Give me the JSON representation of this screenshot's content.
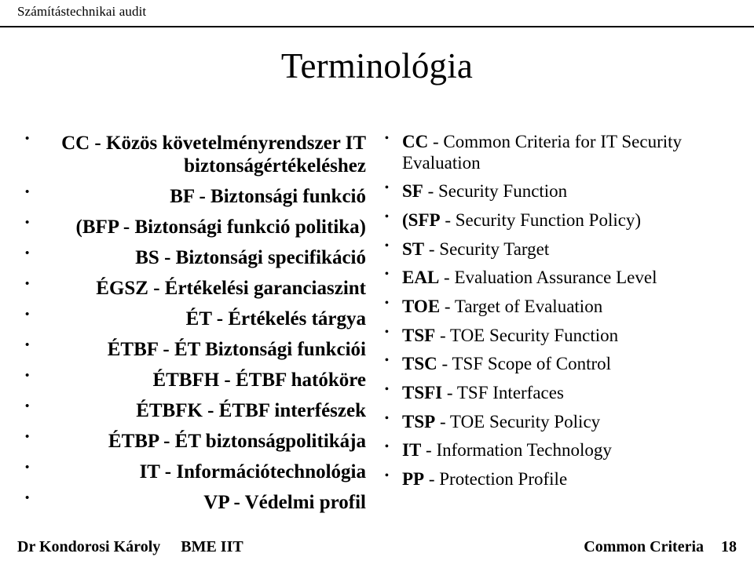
{
  "header": {
    "text": "Számítástechnikai audit"
  },
  "title": "Terminológia",
  "left_column": [
    "CC - Közös követelményrendszer IT biztonságértékeléshez",
    "BF - Biztonsági funkció",
    "(BFP - Biztonsági funkció politika)",
    "BS - Biztonsági specifikáció",
    "ÉGSZ - Értékelési garanciaszint",
    "ÉT - Értékelés tárgya",
    "ÉTBF - ÉT Biztonsági funkciói",
    "ÉTBFH - ÉTBF hatóköre",
    "ÉTBFK - ÉTBF interfészek",
    "ÉTBP - ÉT biztonságpolitikája",
    "IT - Információtechnológia",
    "VP - Védelmi profil"
  ],
  "right_column": [
    {
      "bold": "CC",
      "rest": " - Common Criteria for IT Security Evaluation"
    },
    {
      "bold": "SF",
      "rest": " - Security Function"
    },
    {
      "bold": "(SFP",
      "rest": " - Security Function Policy)"
    },
    {
      "bold": "ST",
      "rest": " - Security Target"
    },
    {
      "bold": "EAL",
      "rest": " - Evaluation Assurance Level"
    },
    {
      "bold": "TOE",
      "rest": " - Target of Evaluation"
    },
    {
      "bold": "TSF",
      "rest": " - TOE Security Function"
    },
    {
      "bold": "TSC",
      "rest": " - TSF Scope of Control"
    },
    {
      "bold": "TSFI",
      "rest": " - TSF Interfaces"
    },
    {
      "bold": "TSP",
      "rest": " - TOE Security Policy"
    },
    {
      "bold": "IT",
      "rest": " - Information Technology"
    },
    {
      "bold": "PP",
      "rest": " - Protection Profile"
    }
  ],
  "footer": {
    "author": "Dr Kondorosi Károly",
    "org": "BME IIT",
    "doc": "Common Criteria",
    "page": "18"
  }
}
